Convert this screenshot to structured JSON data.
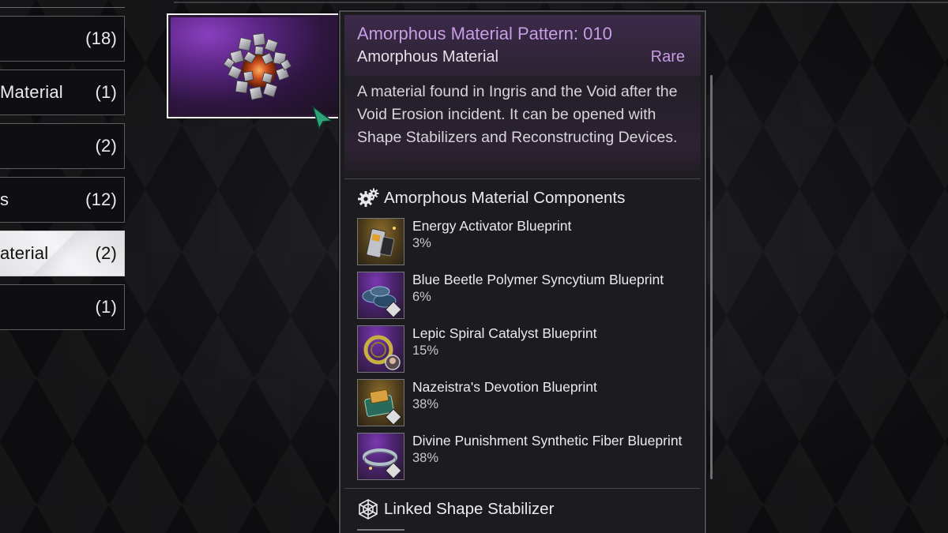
{
  "categories": [
    {
      "label": "",
      "count": "(18)"
    },
    {
      "label": "Material",
      "count": "(1)"
    },
    {
      "label": "",
      "count": "(2)"
    },
    {
      "label": "s",
      "count": "(12)"
    },
    {
      "label": "aterial",
      "count": "(2)",
      "selected": true
    },
    {
      "label": "",
      "count": "(1)"
    }
  ],
  "tooltip": {
    "title": "Amorphous Material Pattern: 010",
    "subtitle": "Amorphous Material",
    "rarity": "Rare",
    "description": "A material found in Ingris and the Void after the Void Erosion incident. It can be opened with Shape Stabilizers and Reconstructing Devices.",
    "components_heading": "Amorphous Material Components",
    "components": [
      {
        "name": "Energy Activator Blueprint",
        "percent": "3%",
        "icon": "energy-activator-icon",
        "rarity_bg": "gold"
      },
      {
        "name": "Blue Beetle Polymer Syncytium Blueprint",
        "percent": "6%",
        "icon": "polymer-syncytium-icon",
        "rarity_bg": "purple"
      },
      {
        "name": "Lepic Spiral Catalyst Blueprint",
        "percent": "15%",
        "icon": "spiral-catalyst-icon",
        "rarity_bg": "purple"
      },
      {
        "name": "Nazeistra's Devotion Blueprint",
        "percent": "38%",
        "icon": "devotion-icon",
        "rarity_bg": "gold"
      },
      {
        "name": "Divine Punishment Synthetic Fiber Blueprint",
        "percent": "38%",
        "icon": "synthetic-fiber-icon",
        "rarity_bg": "purple"
      }
    ],
    "linked_heading": "Linked Shape Stabilizer"
  },
  "colors": {
    "rare_accent": "#c79de4",
    "panel_bg": "#1c1c1f",
    "selected_category_bg": "#f0f0f2"
  }
}
